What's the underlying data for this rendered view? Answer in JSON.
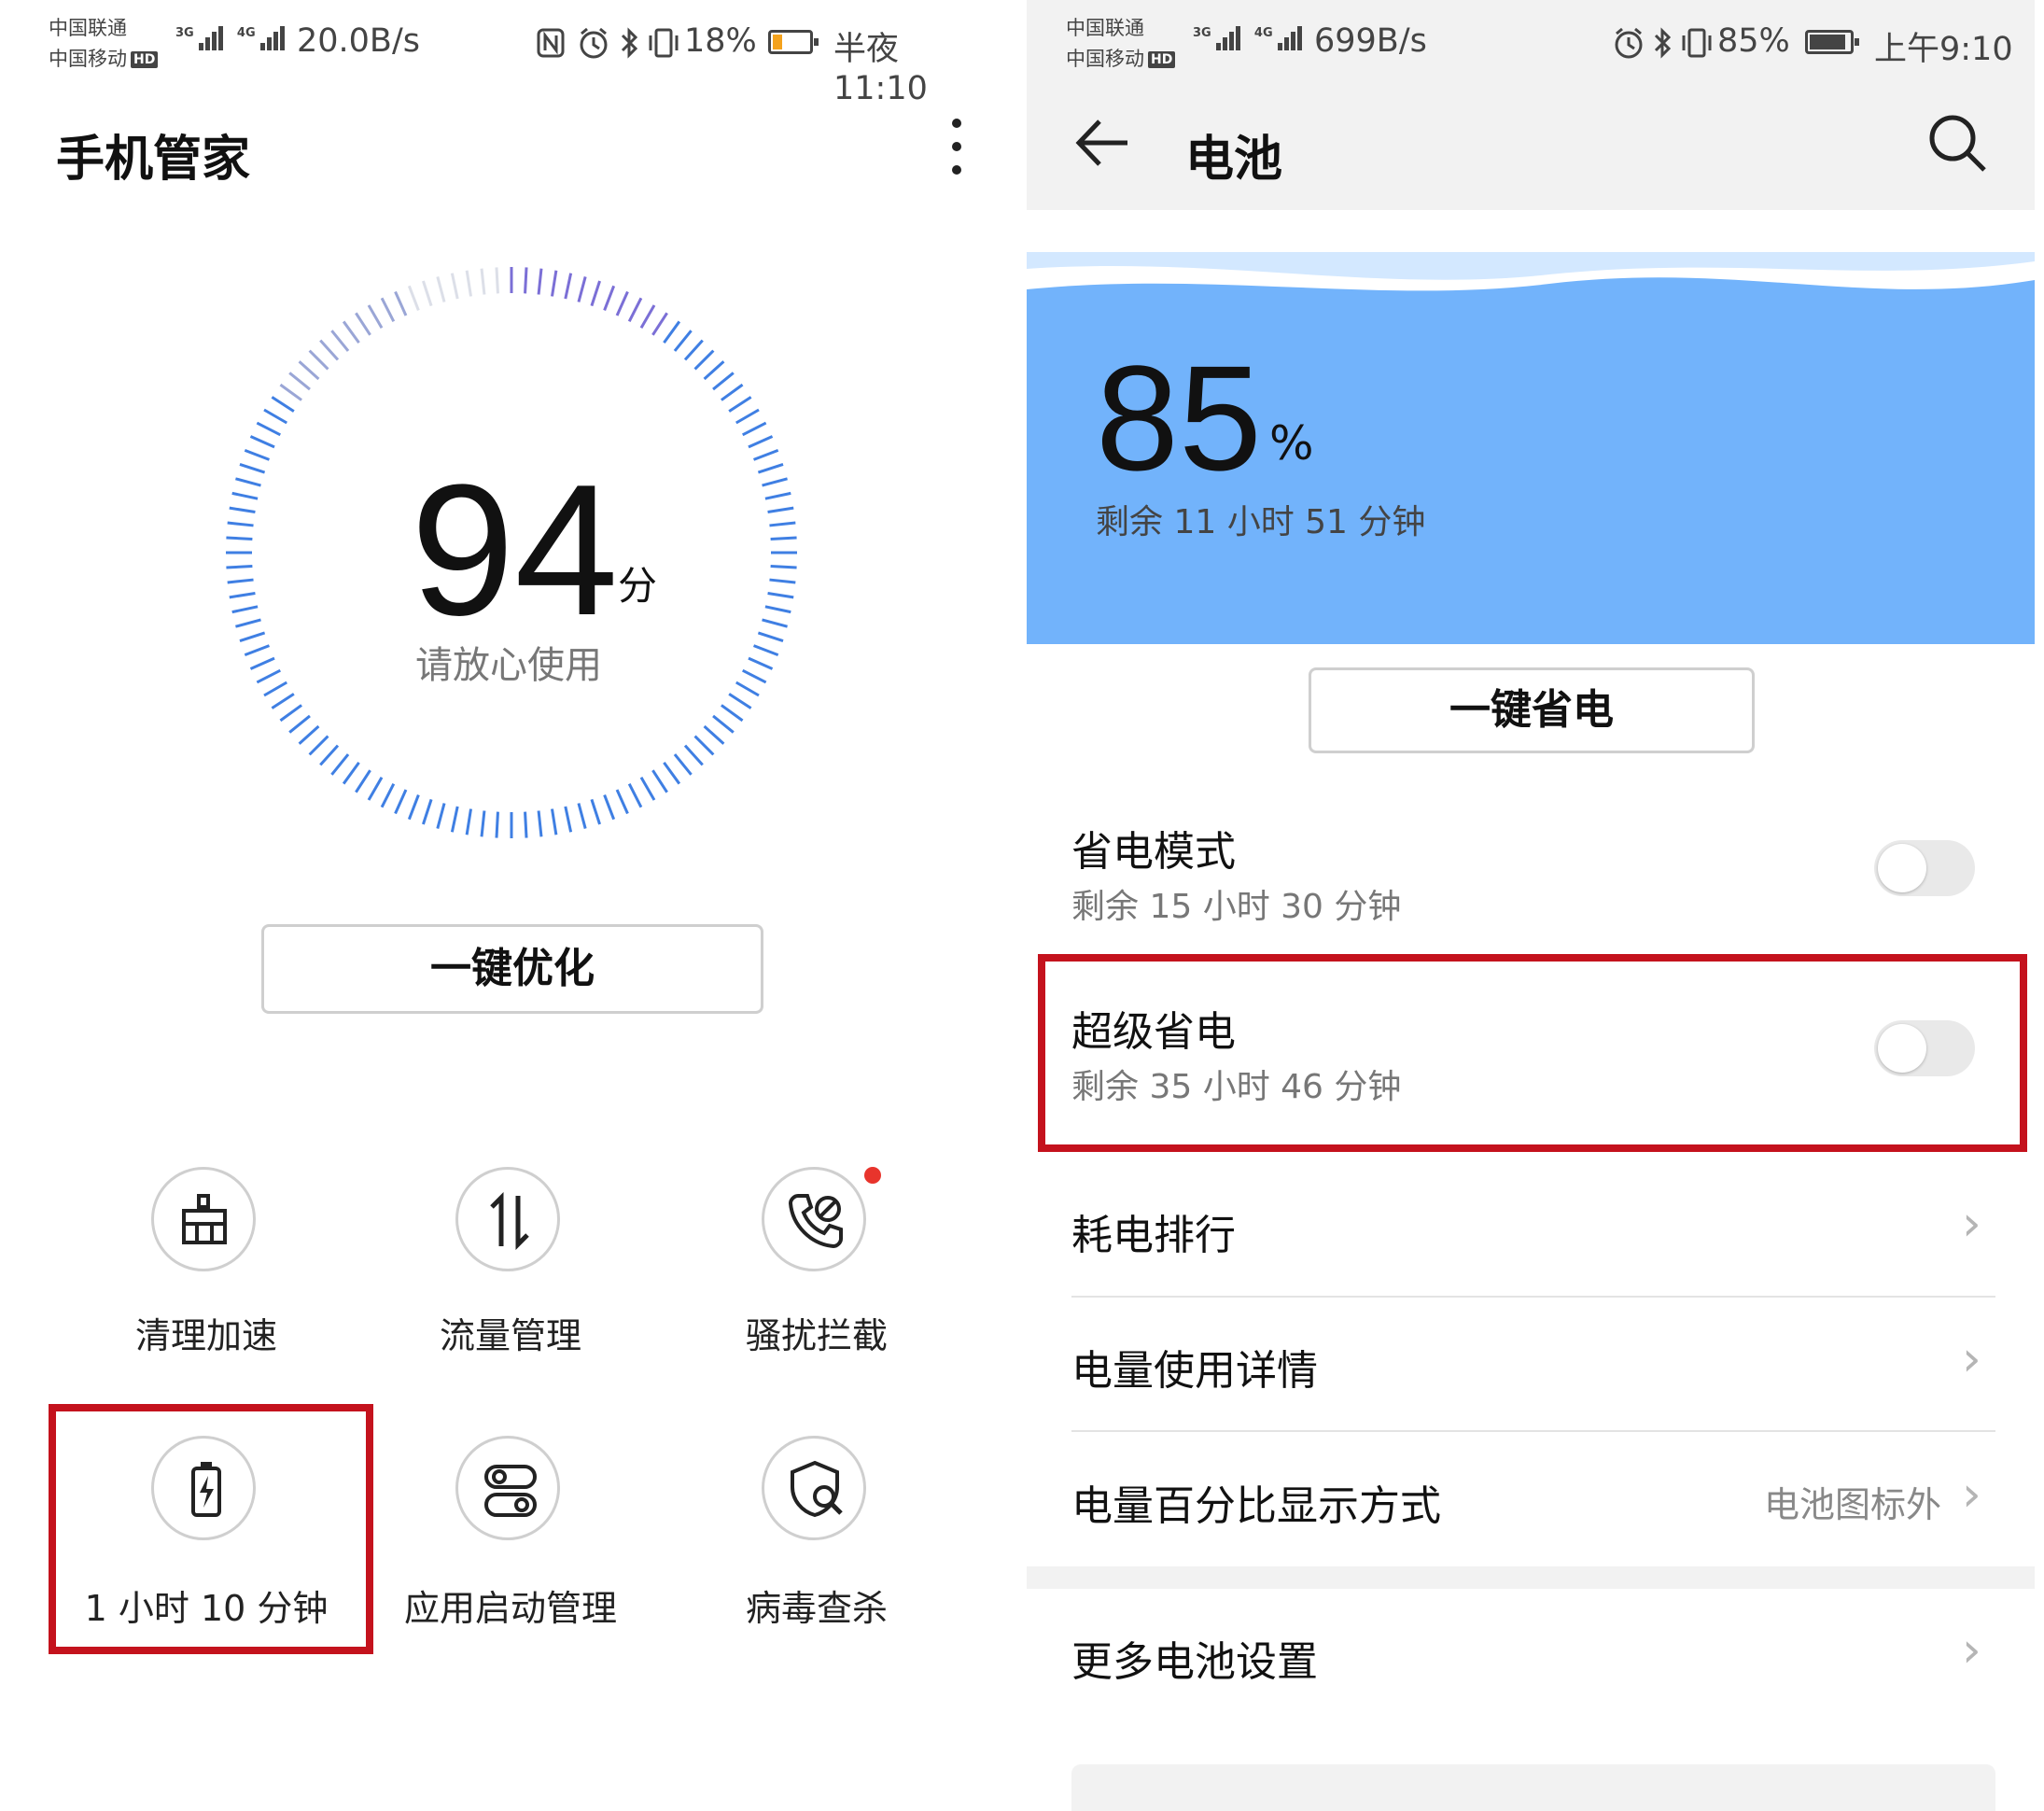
{
  "left": {
    "status": {
      "carrier1": "中国联通",
      "carrier2": "中国移动",
      "hd": "HD",
      "net1": "3G",
      "net2": "4G",
      "speed": "20.0B/s",
      "battery_percent": "18%",
      "time": "半夜11:10"
    },
    "title": "手机管家",
    "score": {
      "value": "94",
      "unit": "分",
      "subtitle": "请放心使用"
    },
    "optimize_button": "一键优化",
    "tools": [
      {
        "label": "清理加速",
        "icon": "broom-icon"
      },
      {
        "label": "流量管理",
        "icon": "data-transfer-icon"
      },
      {
        "label": "骚扰拦截",
        "icon": "call-block-icon",
        "badge": true
      },
      {
        "label": "1 小时 10 分钟",
        "icon": "battery-icon",
        "highlighted": true
      },
      {
        "label": "应用启动管理",
        "icon": "app-launch-icon"
      },
      {
        "label": "病毒查杀",
        "icon": "virus-scan-icon"
      }
    ]
  },
  "right": {
    "status": {
      "carrier1": "中国联通",
      "carrier2": "中国移动",
      "hd": "HD",
      "net1": "3G",
      "net2": "4G",
      "speed": "699B/s",
      "battery_percent": "85%",
      "time": "上午9:10"
    },
    "title": "电池",
    "battery": {
      "percent": "85",
      "unit": "%",
      "remaining": "剩余 11 小时 51 分钟"
    },
    "save_button": "一键省电",
    "modes": [
      {
        "title": "省电模式",
        "subtitle": "剩余 15 小时 30 分钟",
        "on": false
      },
      {
        "title": "超级省电",
        "subtitle": "剩余 35 小时 46 分钟",
        "on": false,
        "highlighted": true
      }
    ],
    "menu": [
      {
        "label": "耗电排行",
        "value": ""
      },
      {
        "label": "电量使用详情",
        "value": ""
      },
      {
        "label": "电量百分比显示方式",
        "value": "电池图标外"
      }
    ],
    "more": {
      "label": "更多电池设置"
    }
  },
  "colors": {
    "accent_blue": "#72b3fb",
    "highlight_red": "#c4121d",
    "badge_red": "#e8342c"
  }
}
